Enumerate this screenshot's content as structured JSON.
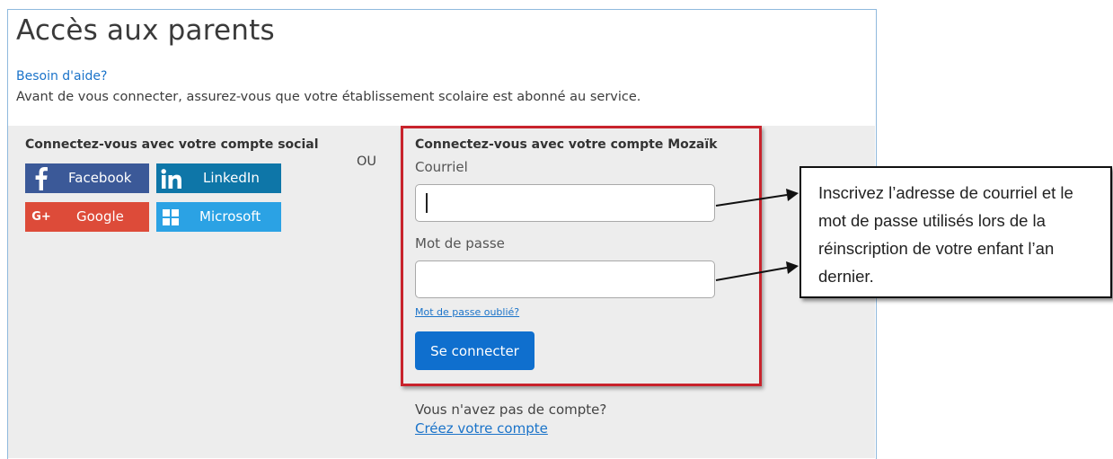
{
  "page": {
    "title": "Accès aux parents",
    "help_link": "Besoin d'aide?",
    "intro": "Avant de vous connecter, assurez-vous que votre établissement scolaire est abonné au service."
  },
  "social": {
    "heading": "Connectez-vous avec votre compte social",
    "buttons": [
      {
        "label": "Facebook",
        "icon": "facebook-icon",
        "color": "#3b5998"
      },
      {
        "label": "LinkedIn",
        "icon": "linkedin-icon",
        "color": "#0e76a8"
      },
      {
        "label": "Google",
        "icon": "google-plus-icon",
        "color": "#dd4b39"
      },
      {
        "label": "Microsoft",
        "icon": "windows-icon",
        "color": "#2ba2e4"
      }
    ]
  },
  "separator": "OU",
  "mozaik": {
    "heading": "Connectez-vous avec votre compte Mozaïk",
    "email_label": "Courriel",
    "email_value": "",
    "password_label": "Mot de passe",
    "password_value": "",
    "forgot_link": "Mot de passe oublié?",
    "login_button": "Se connecter",
    "no_account_text": "Vous n'avez pas de compte?",
    "create_account_link": "Créez votre compte",
    "highlight_color": "#c8232c"
  },
  "callout": {
    "text": "Inscrivez l’adresse de courriel et le mot de passe utilisés lors de la réinscription de votre enfant l’an dernier."
  }
}
